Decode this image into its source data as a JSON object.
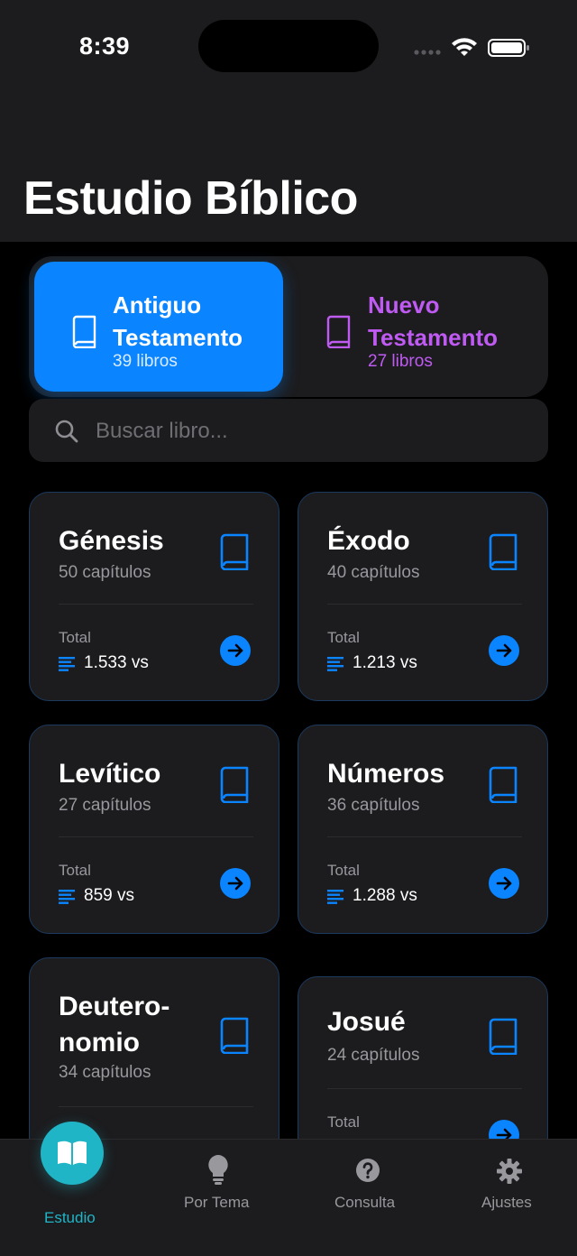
{
  "status_bar": {
    "time": "8:39"
  },
  "header": {
    "title": "Estudio Bíblico"
  },
  "segments": [
    {
      "title": "Antiguo Testamento",
      "subtitle": "39 libros",
      "selected": true,
      "color": "#0a84ff"
    },
    {
      "title": "Nuevo Testamento",
      "subtitle": "27 libros",
      "selected": false,
      "color": "#bf5af2"
    }
  ],
  "search": {
    "placeholder": "Buscar libro..."
  },
  "books": [
    {
      "name": "Génesis",
      "chapters": "50 capítulos",
      "total_label": "Total",
      "verses": "1.533 vs"
    },
    {
      "name": "Éxodo",
      "chapters": "40 capítulos",
      "total_label": "Total",
      "verses": "1.213 vs"
    },
    {
      "name": "Levítico",
      "chapters": "27 capítulos",
      "total_label": "Total",
      "verses": "859 vs"
    },
    {
      "name": "Números",
      "chapters": "36 capítulos",
      "total_label": "Total",
      "verses": "1.288 vs"
    },
    {
      "name": "Deutero-\nnomio",
      "chapters": "34 capítulos",
      "total_label": "",
      "verses": ""
    },
    {
      "name": "Josué",
      "chapters": "24 capítulos",
      "total_label": "Total",
      "verses": ""
    }
  ],
  "tabbar": {
    "tabs": [
      {
        "label": "Estudio",
        "icon": "book-open-icon",
        "active": true
      },
      {
        "label": "Por Tema",
        "icon": "lightbulb-icon",
        "active": false
      },
      {
        "label": "Consulta",
        "icon": "question-circle-icon",
        "active": false
      },
      {
        "label": "Ajustes",
        "icon": "gear-icon",
        "active": false
      }
    ],
    "active_color": "#1fb5c6"
  },
  "colors": {
    "accent": "#0a84ff",
    "new_testament": "#bf5af2",
    "background": "#000000",
    "card": "#1c1c1e"
  }
}
